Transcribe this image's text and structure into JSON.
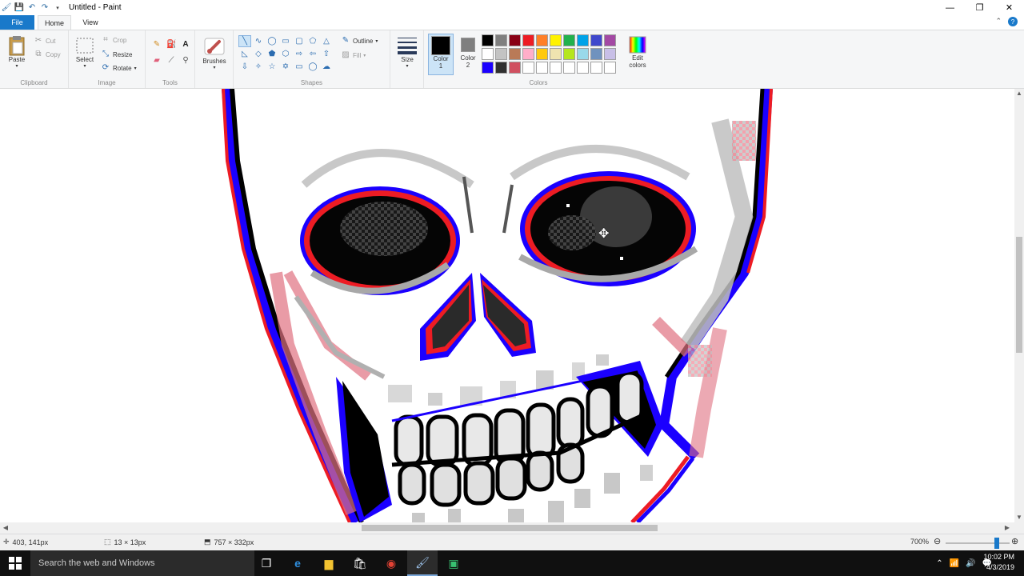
{
  "window": {
    "title": "Untitled - Paint",
    "quick_access": [
      "save-icon",
      "undo-icon",
      "redo-icon",
      "customize-icon"
    ],
    "controls": {
      "minimize": "—",
      "maximize": "❐",
      "close": "✕"
    }
  },
  "tabs": {
    "file": "File",
    "home": "Home",
    "view": "View"
  },
  "ribbon": {
    "clipboard": {
      "label": "Clipboard",
      "paste": "Paste",
      "cut": "Cut",
      "copy": "Copy"
    },
    "image": {
      "label": "Image",
      "select": "Select",
      "crop": "Crop",
      "resize": "Resize",
      "rotate": "Rotate"
    },
    "tools": {
      "label": "Tools"
    },
    "brushes": {
      "label": "Brushes"
    },
    "shapes": {
      "label": "Shapes",
      "outline": "Outline",
      "fill": "Fill"
    },
    "size": {
      "label": "Size"
    },
    "colors": {
      "label": "Colors",
      "color1_line1": "Color",
      "color1_line2": "1",
      "color2_line1": "Color",
      "color2_line2": "2",
      "color1_value": "#000000",
      "color2_value": "#7f7f7f",
      "edit_line1": "Edit",
      "edit_line2": "colors",
      "palette": [
        "#000000",
        "#7f7f7f",
        "#880015",
        "#ed1c24",
        "#ff7f27",
        "#fff200",
        "#22b14c",
        "#00a2e8",
        "#3f48cc",
        "#a349a4",
        "#ffffff",
        "#c3c3c3",
        "#b97a57",
        "#ffaec9",
        "#ffc90e",
        "#efe4b0",
        "#b5e61d",
        "#99d9ea",
        "#7092be",
        "#c8bfe7",
        "#1b00ff",
        "#303030",
        "#d05060",
        "#ffffff",
        "#ffffff",
        "#ffffff",
        "#ffffff",
        "#ffffff",
        "#ffffff",
        "#ffffff"
      ]
    }
  },
  "status": {
    "cursor_pos": "403, 141px",
    "selection_size": "13 × 13px",
    "image_size": "757 × 332px",
    "zoom": "700%"
  },
  "taskbar": {
    "search_placeholder": "Search the web and Windows",
    "time": "10:02 PM",
    "date": "4/3/2019"
  }
}
